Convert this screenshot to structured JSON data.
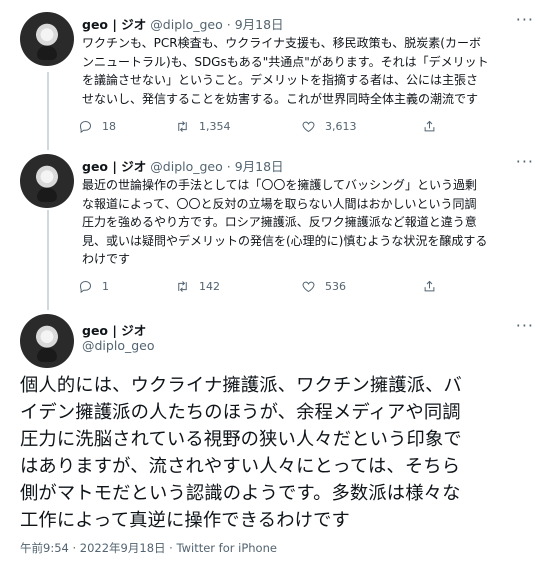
{
  "tweets": [
    {
      "author": "geo | ジオ",
      "handle": "@diplo_geo",
      "date": "9月18日",
      "text": "ワクチンも、PCR検査も、ウクライナ支援も、移民政策も、脱炭素(カーボ\nンニュートラル)も、SDGsもある\"共通点\"があります。それは「デメリット\nを議論させない」ということ。デメリットを指摘する者は、公には主張さ\nせないし、発信することを妨害する。これが世界同時全体主義の潮流です",
      "replies": "18",
      "retweets": "1,354",
      "likes": "3,613"
    },
    {
      "author": "geo | ジオ",
      "handle": "@diplo_geo",
      "date": "9月18日",
      "text": "最近の世論操作の手法としては「〇〇を擁護してバッシング」という過剰\nな報道によって、〇〇と反対の立場を取らない人間はおかしいという同調\n圧力を強めるやり方です。ロシア擁護派、反ワク擁護派など報道と違う意\n見、或いは疑問やデメリットの発信を(心理的に)慎むような状況を醸成する\nわけです",
      "replies": "1",
      "retweets": "142",
      "likes": "536"
    }
  ],
  "main_tweet": {
    "author": "geo | ジオ",
    "handle": "@diplo_geo",
    "text": "個人的には、ウクライナ擁護派、ワクチン擁護派、バ\nイデン擁護派の人たちのほうが、余程メディアや同調\n圧力に洗脳されている視野の狭い人々だという印象で\nはありますが、流されやすい人々にとっては、そちら\n側がマトモだという認識のようです。多数派は様々な\n工作によって真逆に操作できるわけです",
    "timestamp": "午前9:54 · 2022年9月18日 · Twitter for iPhone"
  },
  "separator": " · ",
  "more_label": "···",
  "icons": [
    "reply-icon",
    "retweet-icon",
    "like-icon",
    "share-icon",
    "more-icon"
  ]
}
